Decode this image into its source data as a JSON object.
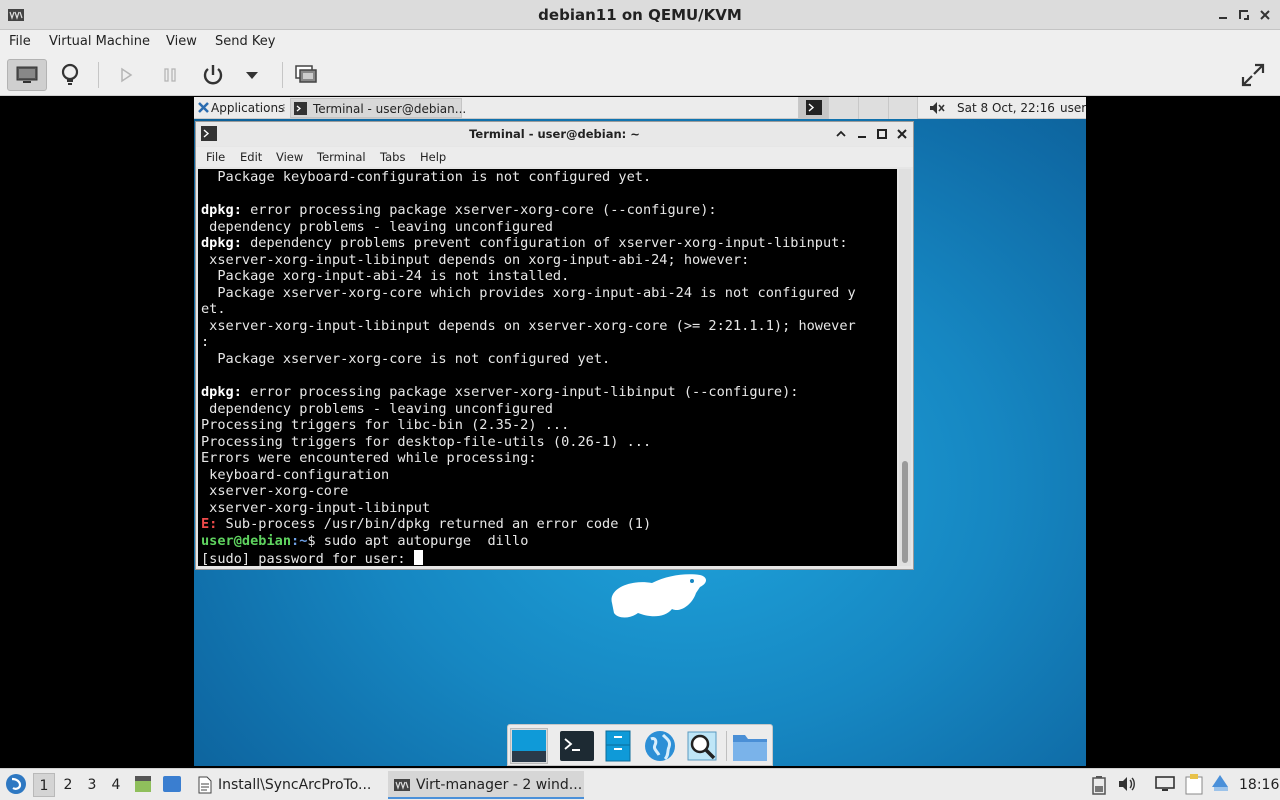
{
  "window": {
    "title": "debian11 on QEMU/KVM"
  },
  "menubar": {
    "items": [
      "File",
      "Virtual Machine",
      "View",
      "Send Key"
    ]
  },
  "guest_panel": {
    "applications_label": "Applications",
    "task_label": "Terminal - user@debian...",
    "clock": "Sat  8 Oct, 22:16",
    "user": "user"
  },
  "terminal": {
    "title": "Terminal - user@debian: ~",
    "menu": [
      "File",
      "Edit",
      "View",
      "Terminal",
      "Tabs",
      "Help"
    ],
    "lines": [
      "  Package keyboard-configuration is not configured yet.",
      "",
      "dpkg: error processing package xserver-xorg-core (--configure):",
      " dependency problems - leaving unconfigured",
      "dpkg: dependency problems prevent configuration of xserver-xorg-input-libinput:",
      " xserver-xorg-input-libinput depends on xorg-input-abi-24; however:",
      "  Package xorg-input-abi-24 is not installed.",
      "  Package xserver-xorg-core which provides xorg-input-abi-24 is not configured y",
      "et.",
      " xserver-xorg-input-libinput depends on xserver-xorg-core (>= 2:21.1.1); however",
      ":",
      "  Package xserver-xorg-core is not configured yet.",
      "",
      "dpkg: error processing package xserver-xorg-input-libinput (--configure):",
      " dependency problems - leaving unconfigured",
      "Processing triggers for libc-bin (2.35-2) ...",
      "Processing triggers for desktop-file-utils (0.26-1) ...",
      "Errors were encountered while processing:",
      " keyboard-configuration",
      " xserver-xorg-core",
      " xserver-xorg-input-libinput"
    ],
    "dpkg_prefix": "dpkg:",
    "error_prefix": "E:",
    "error_text": " Sub-process /usr/bin/dpkg returned an error code (1)",
    "prompt_user": "user@debian",
    "prompt_path": ":~",
    "prompt_symbol": "$ ",
    "command": "sudo apt autopurge  dillo",
    "sudo_prompt": "[sudo] password for user: "
  },
  "host_panel": {
    "workspaces": [
      "1",
      "2",
      "3",
      "4"
    ],
    "active_workspace": "1",
    "tasks": [
      {
        "label": "Install\\SyncArcProTo...",
        "icon": "document-icon"
      },
      {
        "label": "Virt-manager - 2 wind...",
        "icon": "virt-manager-icon"
      }
    ],
    "clock": "18:16"
  },
  "colors": {
    "desktop": "#1687c2",
    "terminal_bg": "#000000",
    "prompt_green": "#5fd35f",
    "prompt_blue": "#6ea0e6",
    "error_red": "#ef4b4b"
  }
}
